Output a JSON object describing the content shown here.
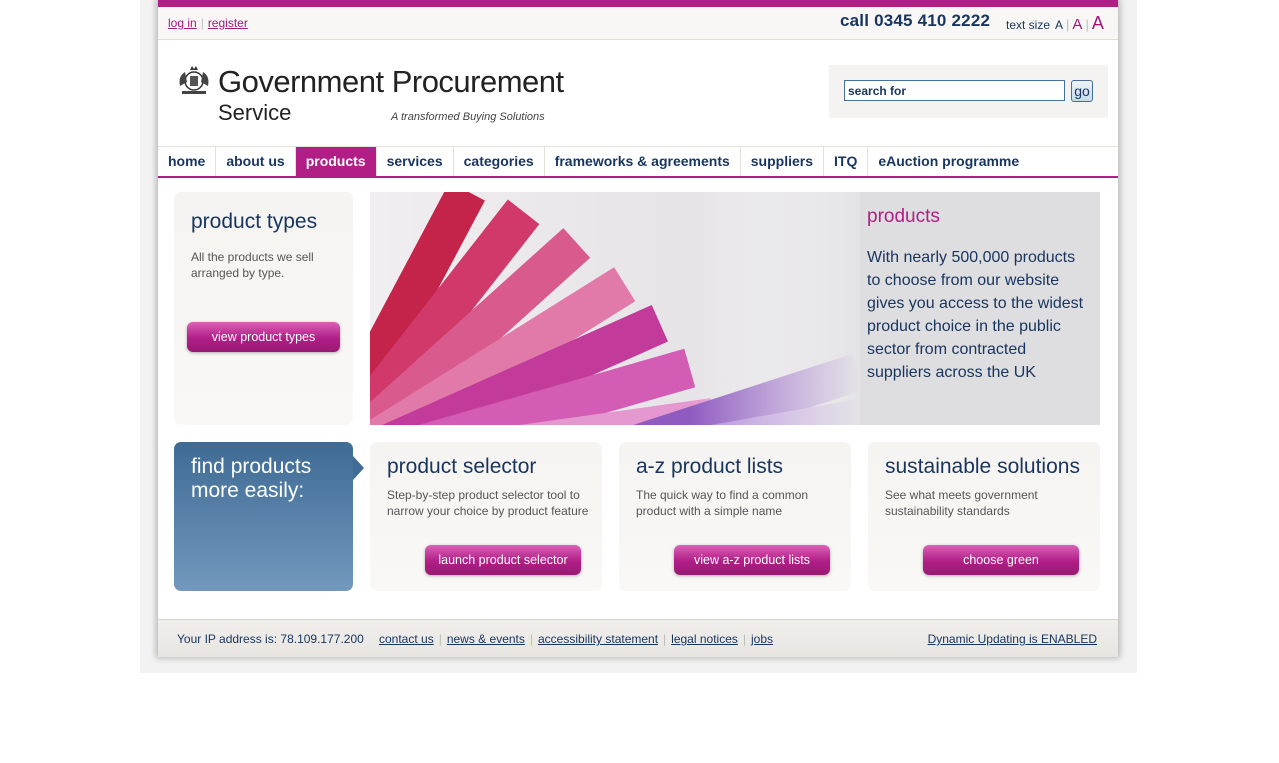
{
  "util": {
    "login": "log in",
    "register": "register",
    "phone": "call 0345 410 2222",
    "text_size_label": "text size",
    "ts_small": "A",
    "ts_medium": "A",
    "ts_large": "A"
  },
  "logo": {
    "line1": "Government Procurement",
    "line2": "Service",
    "tagline": "A transformed Buying Solutions"
  },
  "search": {
    "placeholder": "search for",
    "go": "go"
  },
  "nav": [
    "home",
    "about us",
    "products",
    "services",
    "categories",
    "frameworks & agreements",
    "suppliers",
    "ITQ",
    "eAuction programme"
  ],
  "product_types": {
    "title": "product types",
    "text": "All the products we sell arranged by type.",
    "button": "view product types"
  },
  "hero": {
    "title": "products",
    "text": "With nearly 500,000 products to choose from our website gives you access to the widest product choice in the public sector from contracted suppliers across the UK"
  },
  "find": {
    "text": "find products more easily:"
  },
  "selector": {
    "title": "product selector",
    "text": "Step-by-step product selector tool to narrow your choice by product feature",
    "button": "launch product selector"
  },
  "az": {
    "title": "a-z product lists",
    "text": "The quick way to find a common product with a simple name",
    "button": "view a-z product lists"
  },
  "sustainable": {
    "title": "sustainable solutions",
    "text": "See what meets government sustainability standards",
    "button": "choose green"
  },
  "footer": {
    "ip": "Your IP address is: 78.109.177.200",
    "links": [
      "contact us",
      "news & events",
      "accessibility statement",
      "legal notices",
      "jobs"
    ],
    "dynamic": "Dynamic Updating is ENABLED"
  },
  "colors": {
    "brand_magenta": "#b01e86",
    "navy": "#17355e",
    "blue_panel": "#3e6a94"
  }
}
